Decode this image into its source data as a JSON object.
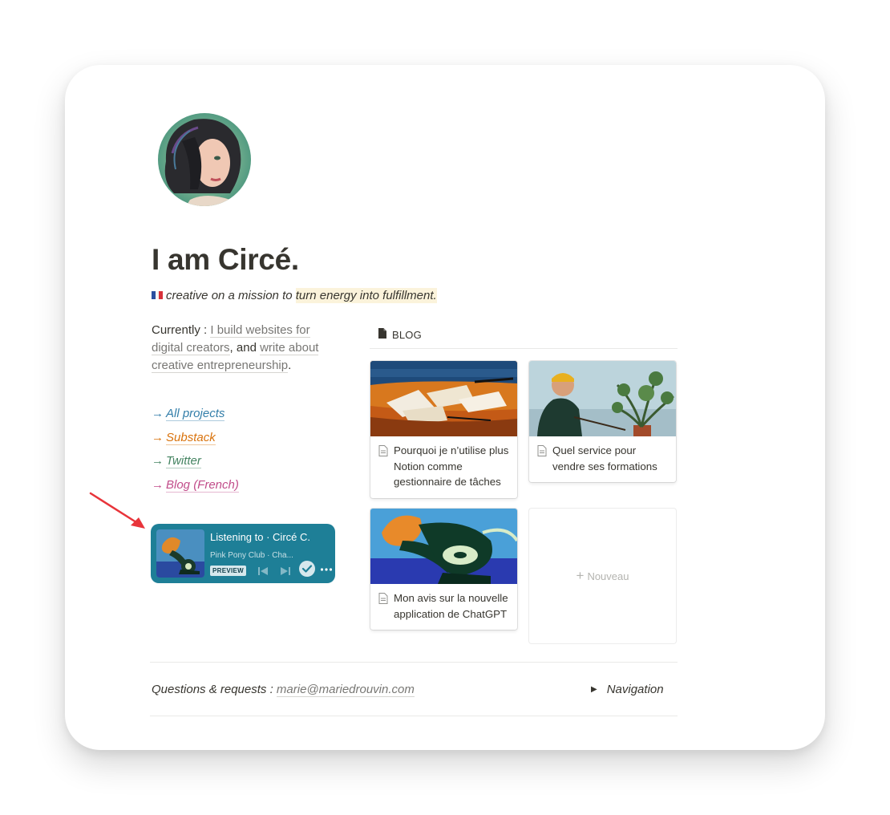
{
  "profile": {
    "title": "I am Circé.",
    "subtitle_prefix": "creative on a mission to ",
    "subtitle_highlight": "turn energy into fulfillment."
  },
  "currently": {
    "label": "Currently : ",
    "link1": "I build websites for digital creators",
    "mid": ", and ",
    "link2": "write about creative entrepreneurship",
    "end": "."
  },
  "links": [
    {
      "arrow": "→",
      "label": "All projects",
      "color": "#337ea9"
    },
    {
      "arrow": "→",
      "label": "Substack",
      "color": "#d9730d"
    },
    {
      "arrow": "→",
      "label": "Twitter",
      "color": "#448361"
    },
    {
      "arrow": "→",
      "label": "Blog (French)",
      "color": "#c14c8a"
    }
  ],
  "spotify": {
    "title": "Listening to · Circé C.",
    "track": "Pink Pony Club · Cha...",
    "badge": "PREVIEW",
    "background": "#1e7f97"
  },
  "blog": {
    "header": "BLOG",
    "cards": [
      {
        "title": "Pourquoi je n’utilise plus Notion comme gestionnaire de tâches"
      },
      {
        "title": "Quel service pour vendre ses formations"
      },
      {
        "title": "Mon avis sur la nouvelle application de ChatGPT"
      }
    ],
    "new_label": "Nouveau"
  },
  "footer": {
    "question_label": "Questions & requests : ",
    "email": "marie@mariedrouvin.com",
    "navigation": "Navigation"
  }
}
